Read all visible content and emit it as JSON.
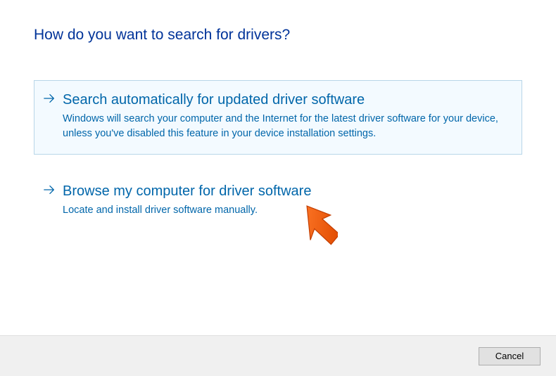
{
  "title": "How do you want to search for drivers?",
  "options": [
    {
      "title": "Search automatically for updated driver software",
      "description": "Windows will search your computer and the Internet for the latest driver software for your device, unless you've disabled this feature in your device installation settings."
    },
    {
      "title": "Browse my computer for driver software",
      "description": "Locate and install driver software manually."
    }
  ],
  "footer": {
    "cancel_label": "Cancel"
  }
}
